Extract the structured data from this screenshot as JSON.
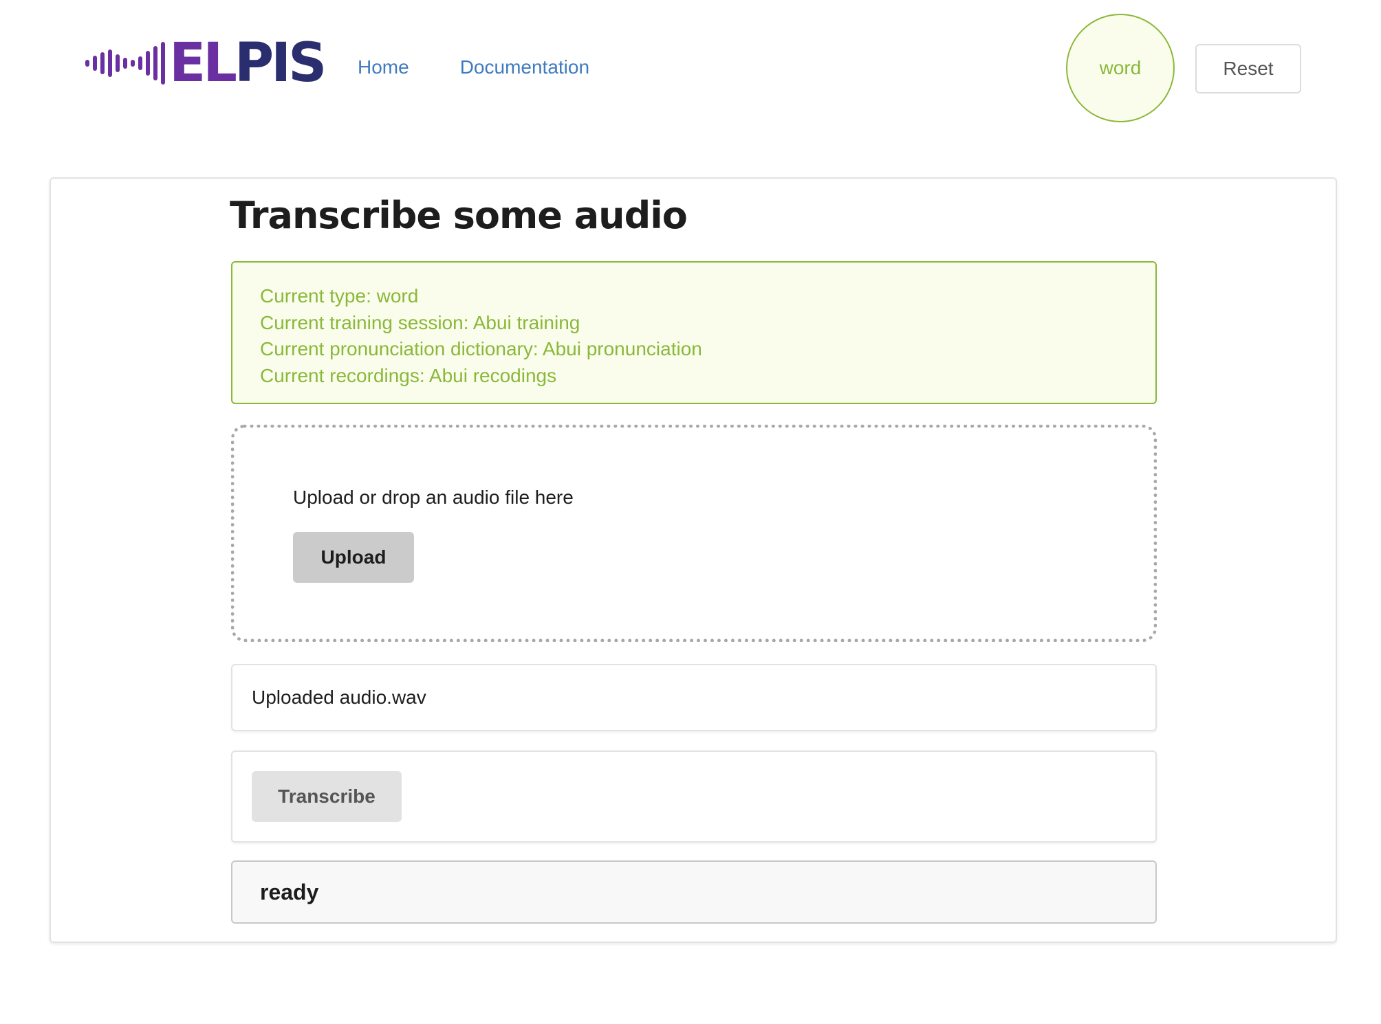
{
  "header": {
    "logo": {
      "text_part1": "EL",
      "text_part2": "PIS",
      "icon": "sound-wave-icon",
      "colors": {
        "primary": "#6a2fa0",
        "secondary": "#2a2d6e"
      }
    },
    "nav": {
      "home_label": "Home",
      "docs_label": "Documentation"
    },
    "type_badge": "word",
    "reset_label": "Reset"
  },
  "main": {
    "title": "Transcribe some audio",
    "info": {
      "line1": "Current type: word",
      "line2": "Current training session: Abui training",
      "line3": "Current pronunciation dictionary: Abui pronunciation",
      "line4": "Current recordings: Abui recodings"
    },
    "dropzone": {
      "text": "Upload or drop an audio file here",
      "upload_label": "Upload"
    },
    "uploaded_text": "Uploaded audio.wav",
    "transcribe_label": "Transcribe",
    "status": "ready"
  },
  "colors": {
    "accent_green": "#8ab83a",
    "info_bg": "#fafdec",
    "link_blue": "#3f7bbf"
  }
}
